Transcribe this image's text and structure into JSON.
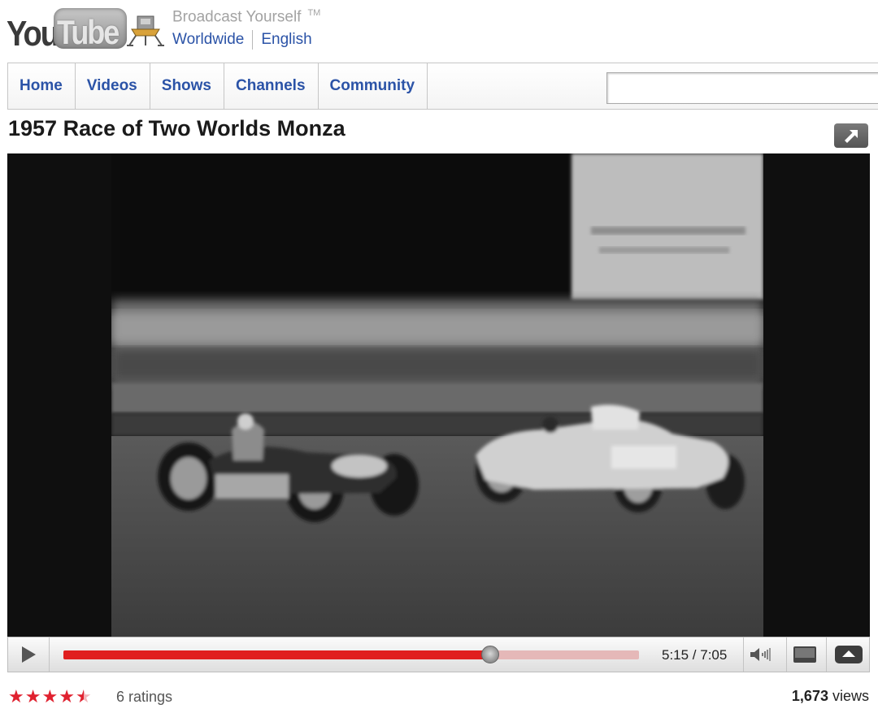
{
  "header": {
    "logo_you": "You",
    "logo_tube": "Tube",
    "tagline": "Broadcast Yourself",
    "trademark": "TM",
    "region": "Worldwide",
    "language": "English"
  },
  "nav": {
    "tabs": [
      "Home",
      "Videos",
      "Shows",
      "Channels",
      "Community"
    ]
  },
  "search": {
    "value": ""
  },
  "video": {
    "title": "1957 Race of Two Worlds Monza",
    "time": "5:15 / 7:05",
    "progress": 0.742
  },
  "stats": {
    "rating": 4.5,
    "ratings_text": "6 ratings",
    "views_count": "1,673",
    "views_label": "views"
  },
  "colors": {
    "link_blue": "#2b53a7",
    "progress_red": "#e01f1f",
    "star_red": "#e0212f"
  },
  "icons": [
    "lunar-lander-icon",
    "popout-icon",
    "play-icon",
    "volume-icon",
    "player-size-icon",
    "fullscreen-icon",
    "star-icon"
  ]
}
